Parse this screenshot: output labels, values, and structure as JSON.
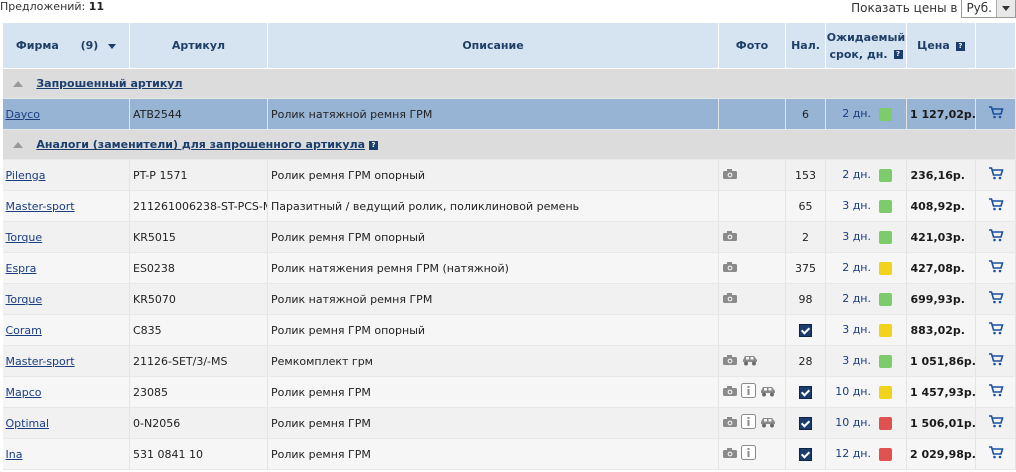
{
  "header": {
    "offers_label": "Предложений:",
    "offers_count": "11",
    "currency_label": "Показать цены в",
    "currency_value": "Руб."
  },
  "columns": {
    "firm": "Фирма",
    "firm_count": "(9)",
    "article": "Артикул",
    "description": "Описание",
    "photo": "Фото",
    "stock": "Нал.",
    "term_line1": "Ожидаемый",
    "term_line2": "срок, дн.",
    "price": "Цена"
  },
  "groups": {
    "requested": "Запрошенный артикул",
    "analogs": "Аналоги (заменители) для запрошенного артикула"
  },
  "requested": {
    "firm": "Dayco",
    "article": "ATB2544",
    "description": "Ролик натяжной ремня ГРМ",
    "photo": "",
    "stock": "6",
    "term": "2 дн.",
    "status": "green",
    "price": "1 127,02р."
  },
  "analogs": [
    {
      "firm": "Pilenga",
      "article": "PT-P 1571",
      "description": "Ролик ремня ГРМ опорный",
      "photo": [
        "camera-icon"
      ],
      "stock": "153",
      "term": "2 дн.",
      "status": "green",
      "price": "236,16р."
    },
    {
      "firm": "Master-sport",
      "article": "211261006238-ST-PCS-MS",
      "description": "Паразитный / ведущий ролик, поликлиновой ремень",
      "photo": [],
      "stock": "65",
      "term": "3 дн.",
      "status": "green",
      "price": "408,92р."
    },
    {
      "firm": "Torque",
      "article": "KR5015",
      "description": "Ролик ремня ГРМ опорный",
      "photo": [
        "camera-icon"
      ],
      "stock": "2",
      "term": "3 дн.",
      "status": "green",
      "price": "421,03р."
    },
    {
      "firm": "Espra",
      "article": "ES0238",
      "description": "Ролик натяжения ремня ГРМ (натяжной)",
      "photo": [
        "camera-icon"
      ],
      "stock": "375",
      "term": "2 дн.",
      "status": "yellow",
      "price": "427,08р."
    },
    {
      "firm": "Torque",
      "article": "KR5070",
      "description": "Ролик натяжной ремня ГРМ",
      "photo": [
        "camera-icon"
      ],
      "stock": "98",
      "term": "2 дн.",
      "status": "green",
      "price": "699,93р."
    },
    {
      "firm": "Coram",
      "article": "C835",
      "description": "Ролик ремня ГРМ опорный",
      "photo": [],
      "stock": "check",
      "term": "3 дн.",
      "status": "yellow",
      "price": "883,02р."
    },
    {
      "firm": "Master-sport",
      "article": "21126-SET/3/-MS",
      "description": "Ремкомплект грм",
      "photo": [
        "camera-icon",
        "car-icon"
      ],
      "stock": "28",
      "term": "3 дн.",
      "status": "green",
      "price": "1 051,86р."
    },
    {
      "firm": "Mapco",
      "article": "23085",
      "description": "Ролик ремня ГРМ",
      "photo": [
        "camera-icon",
        "info-icon",
        "car-icon"
      ],
      "stock": "check",
      "term": "10 дн.",
      "status": "yellow",
      "price": "1 457,93р."
    },
    {
      "firm": "Optimal",
      "article": "0-N2056",
      "description": "Ролик ремня ГРМ",
      "photo": [
        "camera-icon",
        "info-icon",
        "car-icon"
      ],
      "stock": "check",
      "term": "10 дн.",
      "status": "red",
      "price": "1 506,01р."
    },
    {
      "firm": "Ina",
      "article": "531 0841 10",
      "description": "Ролик ремня ГРМ",
      "photo": [
        "camera-icon",
        "info-icon"
      ],
      "stock": "check",
      "term": "12 дн.",
      "status": "red",
      "price": "2 029,98р."
    }
  ],
  "colors": {
    "green": "#7ccc6c",
    "yellow": "#f1d31c",
    "red": "#e0524f",
    "header_bg": "#d6e4f2",
    "requested_bg": "#97b4d4"
  }
}
